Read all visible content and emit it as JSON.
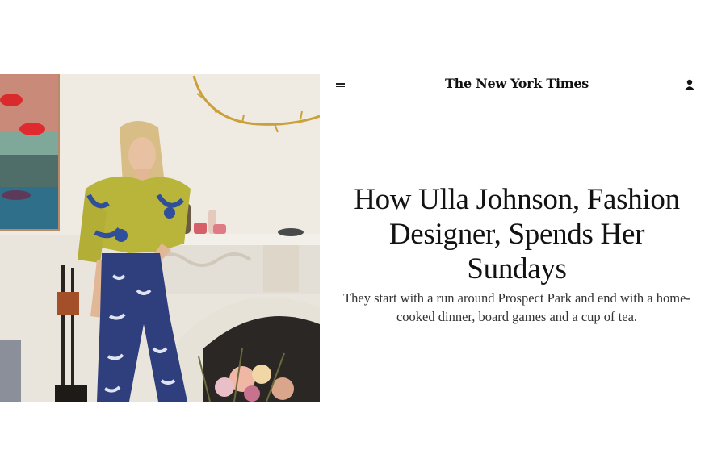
{
  "header": {
    "menu_icon": "hamburger-menu-icon",
    "logo_text": "The New York Times",
    "account_icon": "user-account-icon"
  },
  "article": {
    "headline": "How Ulla Johnson, Fashion Designer, Spends Her Sundays",
    "summary": "They start with a run around Prospect Park and end with a home-cooked dinner, board games and a cup of tea."
  },
  "hero_image": {
    "subject": "woman in yellow ruffled blouse and blue floral pants leaning on white marble fireplace"
  }
}
